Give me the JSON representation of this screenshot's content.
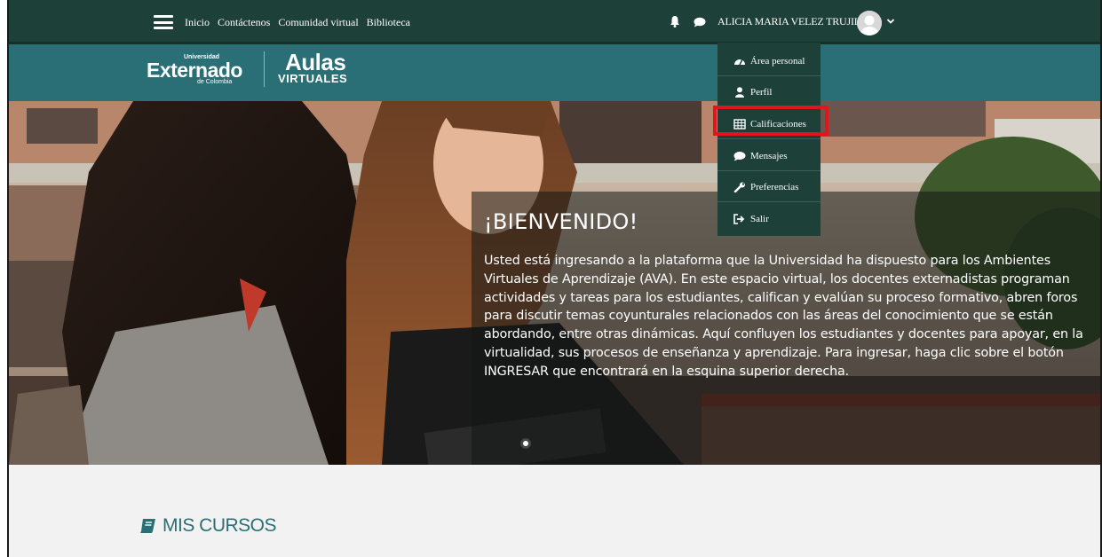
{
  "topnav": {
    "links": [
      "Inicio",
      "Contáctenos",
      "Comunidad virtual",
      "Biblioteca"
    ],
    "username": "ALICIA MARIA VELEZ TRUJILLO"
  },
  "brand": {
    "logo_small": "Universidad",
    "logo_name": "Externado",
    "logo_sub": "de Colombia",
    "logo2_main": "Aulas",
    "logo2_sub": "VIRTUALES"
  },
  "dropdown": {
    "items": [
      {
        "label": "Área personal",
        "icon": "dashboard-icon"
      },
      {
        "label": "Perfil",
        "icon": "user-icon"
      },
      {
        "label": "Calificaciones",
        "icon": "table-icon"
      },
      {
        "label": "Mensajes",
        "icon": "message-icon"
      },
      {
        "label": "Preferencias",
        "icon": "wrench-icon"
      },
      {
        "label": "Salir",
        "icon": "sign-out-icon"
      }
    ],
    "highlighted": "Calificaciones"
  },
  "hero": {
    "title": "¡BIENVENIDO!",
    "text": "Usted está ingresando a la plataforma que la Universidad ha dispuesto para los Ambientes Virtuales de Aprendizaje (AVA). En este espacio virtual, los docentes externadistas programan actividades y tareas para los estudiantes, califican y evalúan su proceso formativo, abren foros para discutir temas coyunturales relacionados con las áreas del conocimiento que se están abordando, entre otras dinámicas. Aquí confluyen los estudiantes y docentes para apoyar, en la virtualidad, sus procesos de enseñanza y aprendizaje. Para ingresar, haga clic sobre el botón INGRESAR que encontrará en la esquina superior derecha."
  },
  "section": {
    "title": "MIS CURSOS"
  },
  "colors": {
    "nav": "#1d4038",
    "brand": "#2a6e76",
    "highlight": "#e3141b"
  }
}
